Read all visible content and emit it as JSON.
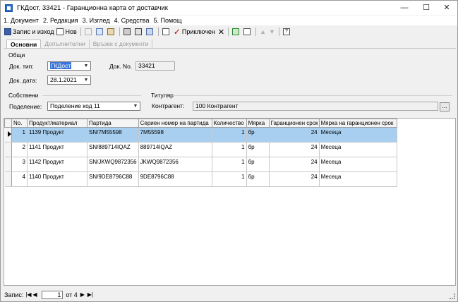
{
  "window": {
    "title": "ГКДост, 33421 - Гаранционна карта от доставчик",
    "minimize_glyph": "—",
    "maximize_glyph": "☐",
    "close_glyph": "✕"
  },
  "menu": [
    "1. Документ",
    "2. Редакция",
    "3. Изглед",
    "4. Средства",
    "5. Помощ"
  ],
  "toolbar": {
    "save_exit": "Запис и изход",
    "new": "Нов",
    "close_doc": "Приключен"
  },
  "tabs": [
    "Основни",
    "Допълнителни",
    "Връзки с документи"
  ],
  "general": {
    "section": "Общи",
    "doc_type_label": "Док. тип:",
    "doc_type_value": "ГКДост",
    "doc_no_label": "Док. No.",
    "doc_no_value": "33421",
    "doc_date_label": "Док. дата:",
    "doc_date_value": "28.1.2021"
  },
  "owner": {
    "section": "Собствени",
    "division_label": "Поделение:",
    "division_value": "Поделение код 11"
  },
  "holder": {
    "section": "Титуляр",
    "contragent_label": "Контрагент:",
    "contragent_value": "100 Контрагент",
    "lookup": "..."
  },
  "grid": {
    "columns": [
      "No.",
      "Продукт/материал",
      "Партида",
      "Сериен номер на партида",
      "Количество",
      "Мярка",
      "Гаранционен срок",
      "Мярка на гаранционен срок"
    ],
    "rows": [
      [
        "1",
        "1139 Продукт",
        "SN/7M55598",
        "7M55598",
        "1",
        "бр",
        "24",
        "Месеца"
      ],
      [
        "2",
        "1141 Продукт",
        "SN/889714IQAZ",
        "889714IQAZ",
        "1",
        "бр",
        "24",
        "Месеца"
      ],
      [
        "3",
        "1142 Продукт",
        "SN/JKWQ9872356",
        "JKWQ9872356",
        "1",
        "бр",
        "24",
        "Месеца"
      ],
      [
        "4",
        "1140 Продукт",
        "SN/9DE8796C88",
        "9DE8796C88",
        "1",
        "бр",
        "24",
        "Месеца"
      ]
    ]
  },
  "status": {
    "record_label": "Запис:",
    "current": "1",
    "of_total": "от 4"
  },
  "colors": {
    "selected_row": "#a9cff0",
    "accent": "#3a74d8"
  }
}
